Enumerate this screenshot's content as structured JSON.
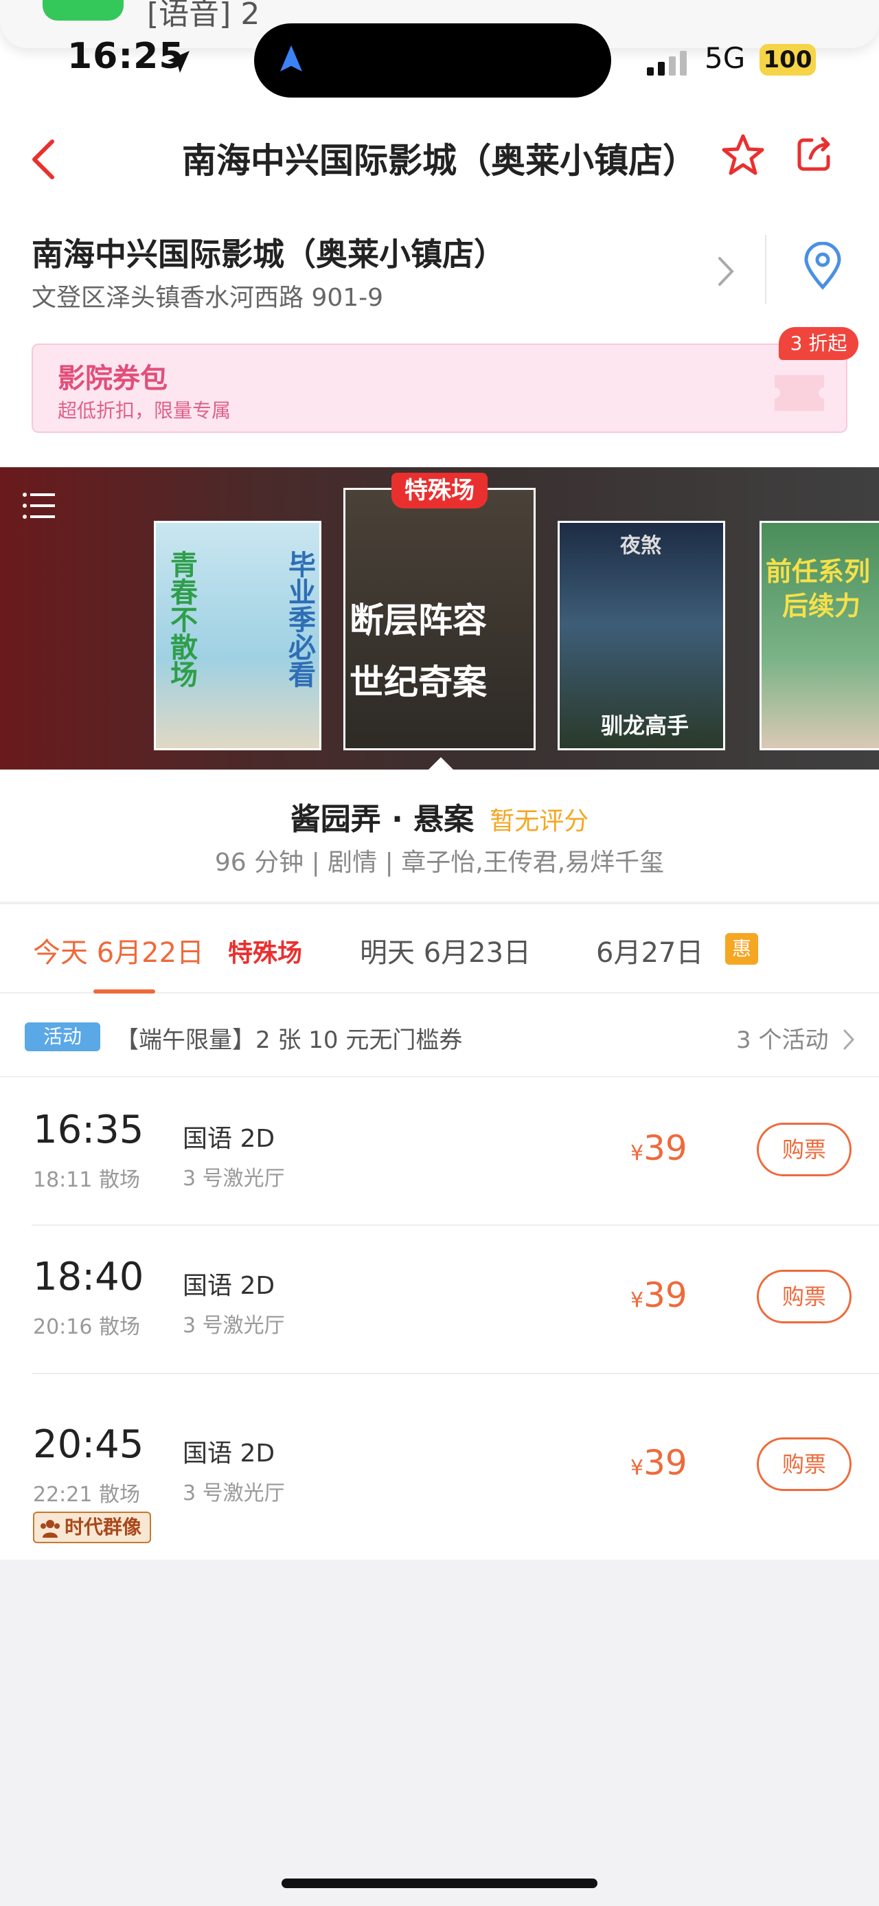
{
  "notification": {
    "text": "[语音] 2"
  },
  "status": {
    "time": "16:25",
    "network": "5G",
    "battery": "100"
  },
  "header": {
    "title": "南海中兴国际影城（奥莱小镇店）"
  },
  "cinema": {
    "name": "南海中兴国际影城（奥莱小镇店）",
    "address": "文登区泽头镇香水河西路 901-9",
    "coupon_title": "影院券包",
    "coupon_subtitle": "超低折扣，限量专属",
    "coupon_badge": "3 折起"
  },
  "carousel": {
    "special_tag": "特殊场",
    "posters": [
      {
        "name": "poster-1",
        "lines": [
          "青春不散场",
          "毕业季必看"
        ]
      },
      {
        "name": "poster-2",
        "lines": [
          "断层阵容",
          "世纪奇案"
        ]
      },
      {
        "name": "poster-3",
        "lines": [
          "夜煞",
          "驯龙高手"
        ]
      },
      {
        "name": "poster-4",
        "lines": [
          "前任系列",
          "后续力"
        ]
      }
    ]
  },
  "movie": {
    "title": "酱园弄 · 悬案",
    "rating": "暂无评分",
    "meta": "96 分钟 | 剧情 | 章子怡,王传君,易烊千玺"
  },
  "tabs": [
    {
      "label": "今天 6月22日",
      "active": true
    },
    {
      "label": "明天 6月23日",
      "active": false
    },
    {
      "label": "6月27日",
      "active": false
    }
  ],
  "tab_special": "特殊场",
  "tab_hui": "惠",
  "activity": {
    "tag": "活动",
    "text": "【端午限量】2 张 10 元无门槛券",
    "count": "3 个活动"
  },
  "showtimes": [
    {
      "time": "16:35",
      "end": "18:11 散场",
      "lang": "国语 2D",
      "hall": "3 号激光厅",
      "price": "39",
      "buy": "购票"
    },
    {
      "time": "18:40",
      "end": "20:16 散场",
      "lang": "国语 2D",
      "hall": "3 号激光厅",
      "price": "39",
      "buy": "购票"
    },
    {
      "time": "20:45",
      "end": "22:21 散场",
      "lang": "国语 2D",
      "hall": "3 号激光厅",
      "price": "39",
      "buy": "购票",
      "badge": "时代群像"
    }
  ],
  "currency": "¥",
  "colors": {
    "accent": "#ee6a3b",
    "special": "#e9302f",
    "activity_tag": "#5aa8e6",
    "rating": "#f5a623"
  }
}
